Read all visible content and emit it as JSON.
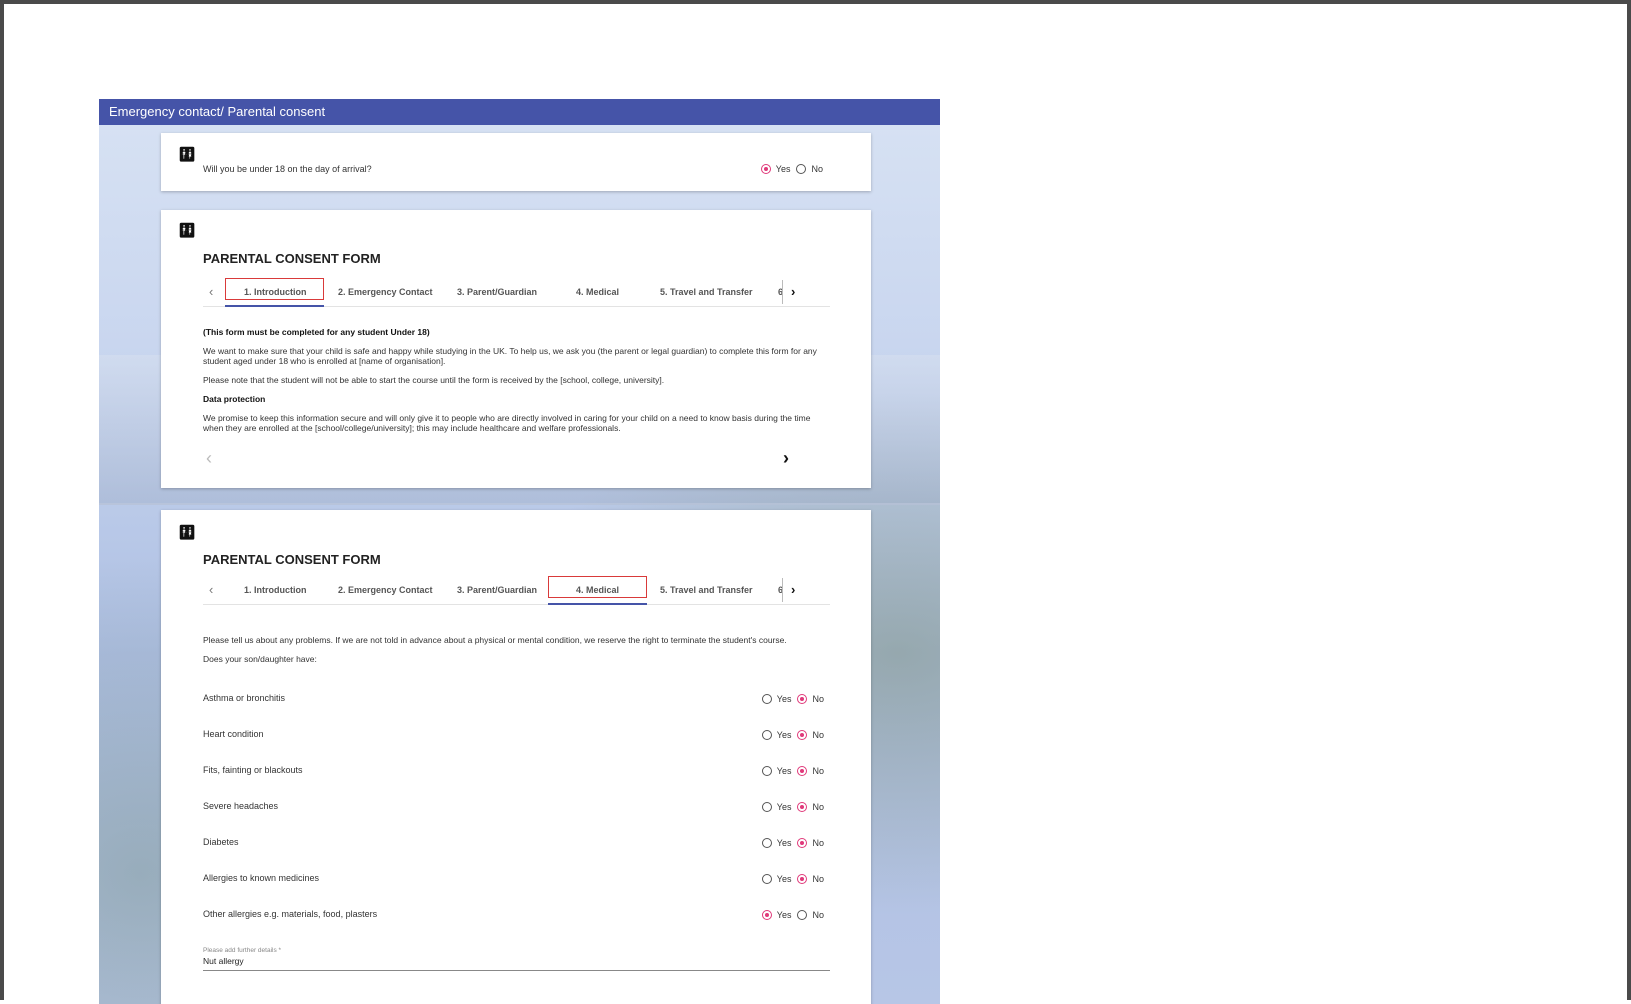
{
  "panel": {
    "title": "Emergency contact/ Parental consent"
  },
  "icons": {
    "person": "people-icon",
    "prev": "chevron-left-icon",
    "next": "chevron-right-icon"
  },
  "colors": {
    "header": "#4554a8",
    "radio_selected": "#e0397a",
    "highlight_box": "#d93a3a"
  },
  "under18": {
    "question": "Will you be under 18 on the day of arrival?",
    "yes_label": "Yes",
    "no_label": "No",
    "selected": "Yes"
  },
  "form1": {
    "title": "PARENTAL CONSENT FORM",
    "tabs": [
      "1. Introduction",
      "2. Emergency Contact",
      "3. Parent/Guardian",
      "4. Medical",
      "5. Travel and Transfer",
      "6"
    ],
    "active_tab": "1. Introduction",
    "intro_heading": "(This form must be completed for any student Under 18)",
    "intro_p1": "We want to make sure that your child is safe and happy while studying in the UK. To help us, we ask you (the parent or legal guardian) to complete this form for any student aged under 18 who is enrolled at [name of organisation].",
    "intro_p2": "Please note that the student will not be able to start the course until the form is received by the [school, college, university].",
    "dp_heading": "Data protection",
    "dp_text": "We promise to keep this information secure and will only give it to people who are directly involved in caring for your child on a need to know basis during the time when they are enrolled at the [school/college/university]; this may include healthcare and welfare professionals."
  },
  "form2": {
    "title": "PARENTAL CONSENT FORM",
    "tabs": [
      "1. Introduction",
      "2. Emergency Contact",
      "3. Parent/Guardian",
      "4. Medical",
      "5. Travel and Transfer",
      "6"
    ],
    "active_tab": "4. Medical",
    "medical_intro": "Please tell us about any problems. If we are not told in advance about a physical or mental condition, we reserve the right to terminate the student's course.",
    "medical_q": "Does your son/daughter have:",
    "yes_label": "Yes",
    "no_label": "No",
    "conditions": [
      {
        "label": "Asthma or bronchitis",
        "selected": "No"
      },
      {
        "label": "Heart condition",
        "selected": "No"
      },
      {
        "label": "Fits, fainting or blackouts",
        "selected": "No"
      },
      {
        "label": "Severe headaches",
        "selected": "No"
      },
      {
        "label": "Diabetes",
        "selected": "No"
      },
      {
        "label": "Allergies to known medicines",
        "selected": "No"
      },
      {
        "label": "Other allergies e.g. materials, food, plasters",
        "selected": "Yes"
      }
    ],
    "details_label": "Please add further details *",
    "details_value": "Nut allergy"
  }
}
